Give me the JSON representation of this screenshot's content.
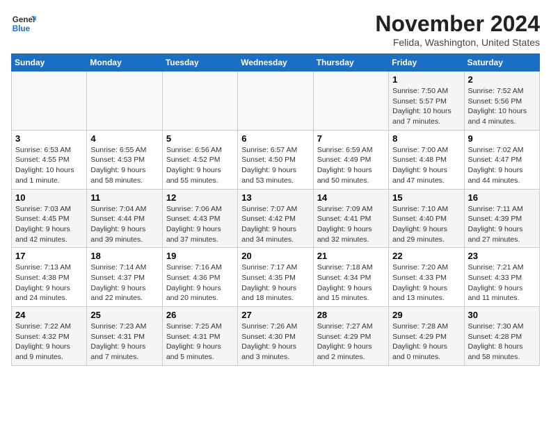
{
  "header": {
    "logo_general": "General",
    "logo_blue": "Blue",
    "month_title": "November 2024",
    "location": "Felida, Washington, United States"
  },
  "weekdays": [
    "Sunday",
    "Monday",
    "Tuesday",
    "Wednesday",
    "Thursday",
    "Friday",
    "Saturday"
  ],
  "weeks": [
    [
      {
        "day": "",
        "info": ""
      },
      {
        "day": "",
        "info": ""
      },
      {
        "day": "",
        "info": ""
      },
      {
        "day": "",
        "info": ""
      },
      {
        "day": "",
        "info": ""
      },
      {
        "day": "1",
        "info": "Sunrise: 7:50 AM\nSunset: 5:57 PM\nDaylight: 10 hours and 7 minutes."
      },
      {
        "day": "2",
        "info": "Sunrise: 7:52 AM\nSunset: 5:56 PM\nDaylight: 10 hours and 4 minutes."
      }
    ],
    [
      {
        "day": "3",
        "info": "Sunrise: 6:53 AM\nSunset: 4:55 PM\nDaylight: 10 hours and 1 minute."
      },
      {
        "day": "4",
        "info": "Sunrise: 6:55 AM\nSunset: 4:53 PM\nDaylight: 9 hours and 58 minutes."
      },
      {
        "day": "5",
        "info": "Sunrise: 6:56 AM\nSunset: 4:52 PM\nDaylight: 9 hours and 55 minutes."
      },
      {
        "day": "6",
        "info": "Sunrise: 6:57 AM\nSunset: 4:50 PM\nDaylight: 9 hours and 53 minutes."
      },
      {
        "day": "7",
        "info": "Sunrise: 6:59 AM\nSunset: 4:49 PM\nDaylight: 9 hours and 50 minutes."
      },
      {
        "day": "8",
        "info": "Sunrise: 7:00 AM\nSunset: 4:48 PM\nDaylight: 9 hours and 47 minutes."
      },
      {
        "day": "9",
        "info": "Sunrise: 7:02 AM\nSunset: 4:47 PM\nDaylight: 9 hours and 44 minutes."
      }
    ],
    [
      {
        "day": "10",
        "info": "Sunrise: 7:03 AM\nSunset: 4:45 PM\nDaylight: 9 hours and 42 minutes."
      },
      {
        "day": "11",
        "info": "Sunrise: 7:04 AM\nSunset: 4:44 PM\nDaylight: 9 hours and 39 minutes."
      },
      {
        "day": "12",
        "info": "Sunrise: 7:06 AM\nSunset: 4:43 PM\nDaylight: 9 hours and 37 minutes."
      },
      {
        "day": "13",
        "info": "Sunrise: 7:07 AM\nSunset: 4:42 PM\nDaylight: 9 hours and 34 minutes."
      },
      {
        "day": "14",
        "info": "Sunrise: 7:09 AM\nSunset: 4:41 PM\nDaylight: 9 hours and 32 minutes."
      },
      {
        "day": "15",
        "info": "Sunrise: 7:10 AM\nSunset: 4:40 PM\nDaylight: 9 hours and 29 minutes."
      },
      {
        "day": "16",
        "info": "Sunrise: 7:11 AM\nSunset: 4:39 PM\nDaylight: 9 hours and 27 minutes."
      }
    ],
    [
      {
        "day": "17",
        "info": "Sunrise: 7:13 AM\nSunset: 4:38 PM\nDaylight: 9 hours and 24 minutes."
      },
      {
        "day": "18",
        "info": "Sunrise: 7:14 AM\nSunset: 4:37 PM\nDaylight: 9 hours and 22 minutes."
      },
      {
        "day": "19",
        "info": "Sunrise: 7:16 AM\nSunset: 4:36 PM\nDaylight: 9 hours and 20 minutes."
      },
      {
        "day": "20",
        "info": "Sunrise: 7:17 AM\nSunset: 4:35 PM\nDaylight: 9 hours and 18 minutes."
      },
      {
        "day": "21",
        "info": "Sunrise: 7:18 AM\nSunset: 4:34 PM\nDaylight: 9 hours and 15 minutes."
      },
      {
        "day": "22",
        "info": "Sunrise: 7:20 AM\nSunset: 4:33 PM\nDaylight: 9 hours and 13 minutes."
      },
      {
        "day": "23",
        "info": "Sunrise: 7:21 AM\nSunset: 4:33 PM\nDaylight: 9 hours and 11 minutes."
      }
    ],
    [
      {
        "day": "24",
        "info": "Sunrise: 7:22 AM\nSunset: 4:32 PM\nDaylight: 9 hours and 9 minutes."
      },
      {
        "day": "25",
        "info": "Sunrise: 7:23 AM\nSunset: 4:31 PM\nDaylight: 9 hours and 7 minutes."
      },
      {
        "day": "26",
        "info": "Sunrise: 7:25 AM\nSunset: 4:31 PM\nDaylight: 9 hours and 5 minutes."
      },
      {
        "day": "27",
        "info": "Sunrise: 7:26 AM\nSunset: 4:30 PM\nDaylight: 9 hours and 3 minutes."
      },
      {
        "day": "28",
        "info": "Sunrise: 7:27 AM\nSunset: 4:29 PM\nDaylight: 9 hours and 2 minutes."
      },
      {
        "day": "29",
        "info": "Sunrise: 7:28 AM\nSunset: 4:29 PM\nDaylight: 9 hours and 0 minutes."
      },
      {
        "day": "30",
        "info": "Sunrise: 7:30 AM\nSunset: 4:28 PM\nDaylight: 8 hours and 58 minutes."
      }
    ]
  ]
}
